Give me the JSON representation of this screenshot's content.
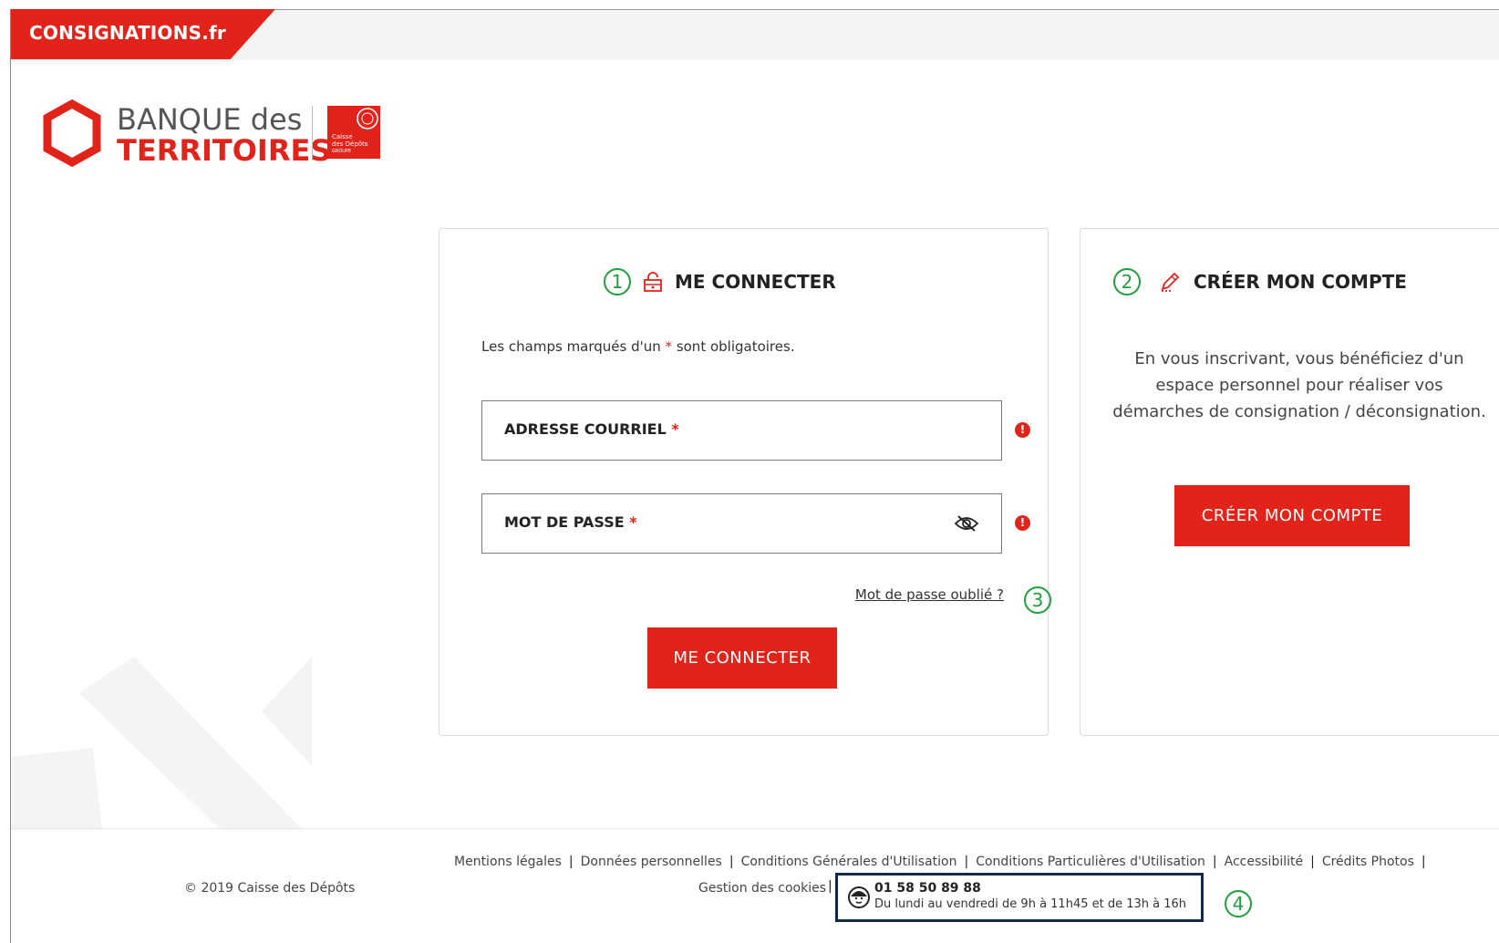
{
  "brand": {
    "tab_label": "CONSIGNATIONS.fr"
  },
  "logo": {
    "line1": "BANQUE des",
    "line2": "TERRITOIRES",
    "cdc_line1": "Caisse",
    "cdc_line2": "des Dépôts",
    "cdc_line3": "GROUPE"
  },
  "login": {
    "marker": "1",
    "title": "ME CONNECTER",
    "mandatory_prefix": "Les champs marqués d'un ",
    "mandatory_star": "*",
    "mandatory_suffix": " sont obligatoires.",
    "email_label": "ADRESSE COURRIEL",
    "password_label": "MOT DE PASSE",
    "required_star": "*",
    "error_glyph": "!",
    "forgot_link": "Mot de passe oublié ?",
    "forgot_marker": "3",
    "submit": "ME CONNECTER"
  },
  "register": {
    "marker": "2",
    "title": "CRÉER MON COMPTE",
    "description": "En vous inscrivant, vous bénéficiez d'un espace personnel pour réaliser vos démarches de consignation / déconsignation.",
    "button": "CRÉER MON COMPTE"
  },
  "footer": {
    "copyright": "© 2019 Caisse des Dépôts",
    "links": [
      "Mentions légales",
      "Données personnelles",
      "Conditions Générales d'Utilisation",
      "Conditions Particulières d'Utilisation",
      "Accessibilité",
      "Crédits Photos"
    ],
    "separator": "|",
    "cookies": "Gestion des cookies",
    "contact_phone": "01 58 50 89 88",
    "contact_hours": "Du lundi au vendredi de 9h à 11h45 et de 13h à 16h",
    "contact_marker": "4"
  },
  "colors": {
    "accent": "#e2231a",
    "marker": "#1f9e3d",
    "contact_border": "#13294b"
  }
}
